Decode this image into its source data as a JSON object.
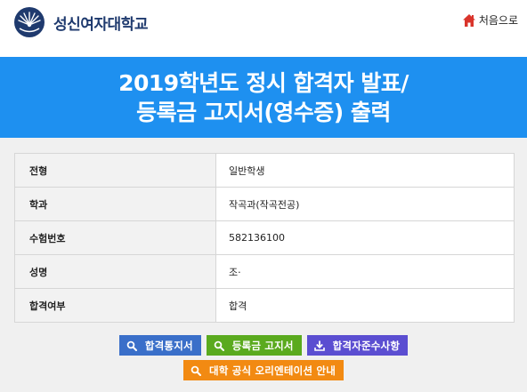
{
  "header": {
    "logo_text": "성신여자대학교",
    "home_label": "처음으로"
  },
  "banner": {
    "line1": "2019학년도 정시 합격자 발표/",
    "line2": "등록금 고지서(영수증) 출력"
  },
  "info": {
    "rows": [
      {
        "label": "전형",
        "value": "일반학생"
      },
      {
        "label": "학과",
        "value": "작곡과(작곡전공)"
      },
      {
        "label": "수험번호",
        "value": "582136100"
      },
      {
        "label": "성명",
        "value": "조·"
      },
      {
        "label": "합격여부",
        "value": "합격"
      }
    ]
  },
  "buttons": {
    "acceptance_notice": "합격통지서",
    "tuition_bill": "등록금 고지서",
    "admitted_guidelines": "합격자준수사항",
    "orientation_guide": "대학 공식 오리엔테이션 안내"
  },
  "colors": {
    "banner": "#1e90f0",
    "btn_blue": "#3a6fc9",
    "btn_green": "#5aaa1e",
    "btn_purple": "#5b4ed1",
    "btn_orange": "#f28a12",
    "home_icon": "#d9342b",
    "logo_text": "#1f3a6e"
  },
  "icons": {
    "logo": "university-emblem-icon",
    "home": "home-icon",
    "search": "search-icon",
    "download": "download-icon"
  }
}
